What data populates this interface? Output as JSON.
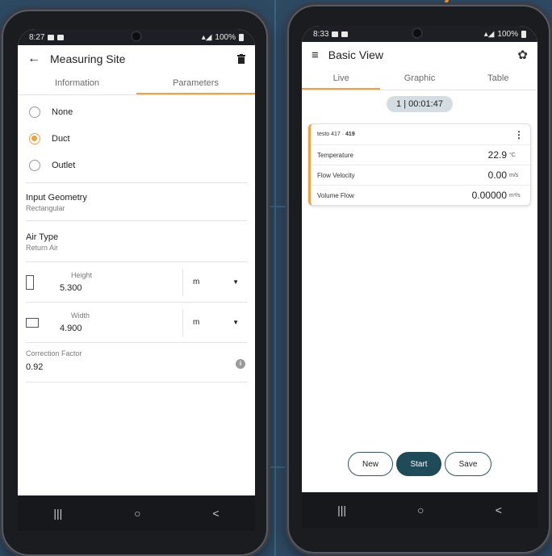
{
  "left_phone": {
    "status": {
      "time": "8:27",
      "battery": "100%"
    },
    "appbar": {
      "back_icon": "arrow-left-icon",
      "title": "Measuring Site",
      "delete_icon": "trash-icon"
    },
    "tabs": [
      {
        "label": "Information",
        "active": false
      },
      {
        "label": "Parameters",
        "active": true
      }
    ],
    "site_types": [
      {
        "label": "None",
        "selected": false
      },
      {
        "label": "Duct",
        "selected": true
      },
      {
        "label": "Outlet",
        "selected": false
      }
    ],
    "input_geometry": {
      "label": "Input Geometry",
      "value": "Rectangular"
    },
    "air_type": {
      "label": "Air Type",
      "value": "Return Air"
    },
    "height": {
      "label": "Height",
      "value": "5.300",
      "unit": "m"
    },
    "width": {
      "label": "Width",
      "value": "4.900",
      "unit": "m"
    },
    "correction_factor": {
      "label": "Correction Factor",
      "value": "0.92"
    }
  },
  "right_phone": {
    "status": {
      "time": "8:33",
      "battery": "100%"
    },
    "appbar": {
      "menu_icon": "hamburger-menu-icon",
      "title": "Basic View",
      "settings_icon": "gear-icon"
    },
    "tabs": [
      {
        "label": "Live",
        "active": true
      },
      {
        "label": "Graphic",
        "active": false
      },
      {
        "label": "Table",
        "active": false
      }
    ],
    "timer": "1 | 00:01:47",
    "device": {
      "name": "testo 417 · ",
      "id": "419"
    },
    "readings": [
      {
        "name": "Temperature",
        "value": "22.9",
        "unit": "°C"
      },
      {
        "name": "Flow Velocity",
        "value": "0.00",
        "unit": "m/s"
      },
      {
        "name": "Volume Flow",
        "value": "0.00000",
        "unit": "m³/s"
      }
    ],
    "buttons": {
      "new": "New",
      "start": "Start",
      "save": "Save"
    }
  },
  "nav": {
    "recents": "|||",
    "home": "○",
    "back": "<"
  },
  "colors": {
    "accent": "#f0a043",
    "primary_button": "#1f4a58",
    "timer_pill": "#d4dde1",
    "background": "#2e4a63"
  }
}
